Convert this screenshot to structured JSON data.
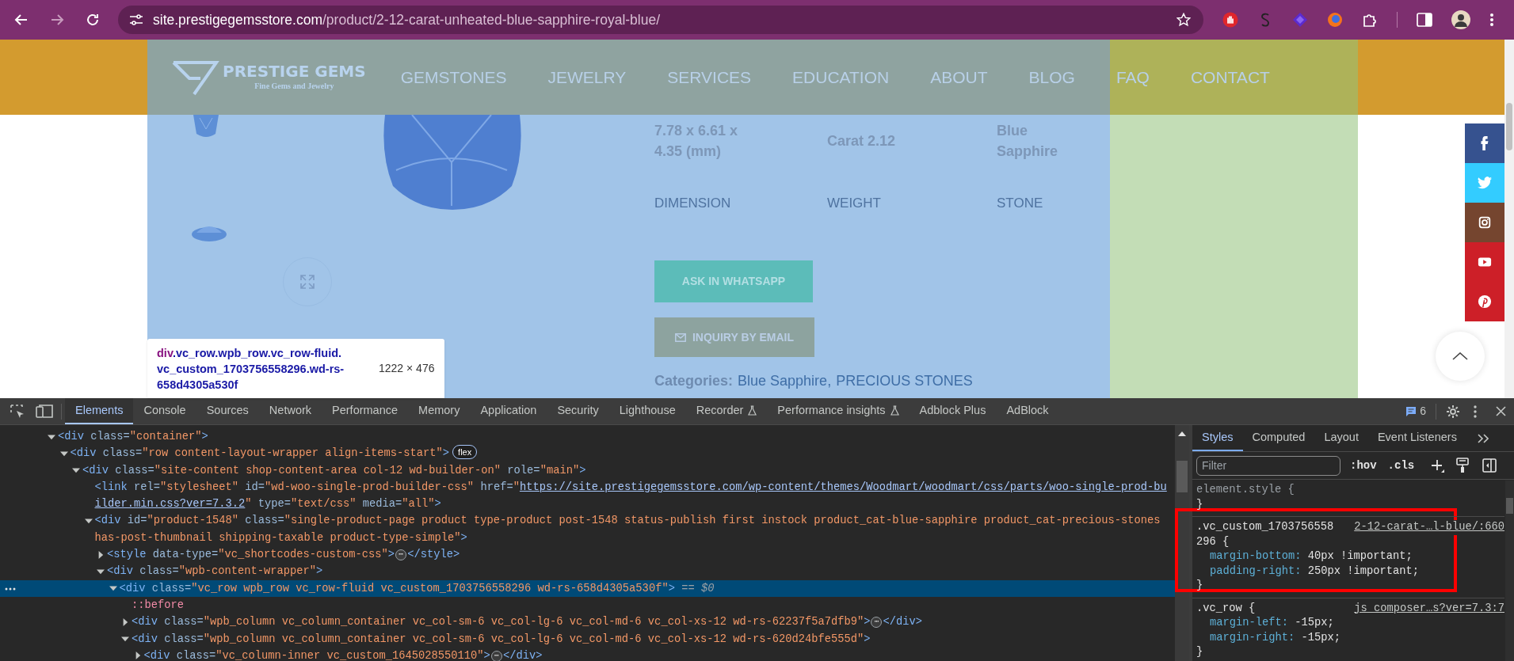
{
  "browser": {
    "url_host": "site.prestigegemsstore.com",
    "url_path": "/product/2-12-carat-unheated-blue-sapphire-royal-blue/"
  },
  "site": {
    "logo": {
      "name": "PRESTIGE GEMS",
      "tagline": "Fine Gems and Jewelry"
    },
    "nav": [
      "GEMSTONES",
      "JEWELRY",
      "SERVICES",
      "EDUCATION",
      "ABOUT",
      "BLOG",
      "FAQ",
      "CONTACT"
    ],
    "specs": [
      {
        "value": "7.78 x 6.61 x 4.35 (mm)",
        "label": "DIMENSION"
      },
      {
        "value": "Carat 2.12",
        "label": "WEIGHT"
      },
      {
        "value": "Blue Sapphire",
        "label": "STONE"
      }
    ],
    "buttons": [
      {
        "kind": "whatsapp",
        "label": "ASK IN WHATSAPP"
      },
      {
        "kind": "email",
        "label": "INQUIRY BY EMAIL"
      }
    ],
    "categories": {
      "label": "Categories:",
      "links": [
        "Blue Sapphire",
        "PRECIOUS STONES"
      ],
      "separator": ","
    },
    "social": [
      {
        "kind": "facebook",
        "color": "#36528f"
      },
      {
        "kind": "twitter",
        "color": "#33ccff"
      },
      {
        "kind": "instagram",
        "color": "#75452f"
      },
      {
        "kind": "youtube",
        "color": "#cd1f28"
      },
      {
        "kind": "pinterest",
        "color": "#cd1f28"
      }
    ]
  },
  "inspect_tooltip": {
    "tag": "div",
    "lines": [
      ".vc_row.wpb_row.vc_row-fluid.",
      "vc_custom_1703756558296.wd-rs-",
      "658d4305a530f"
    ],
    "size": "1222 × 476"
  },
  "devtools": {
    "tabs": [
      {
        "label": "Elements",
        "selected": true,
        "experimental": false
      },
      {
        "label": "Console",
        "selected": false,
        "experimental": false
      },
      {
        "label": "Sources",
        "selected": false,
        "experimental": false
      },
      {
        "label": "Network",
        "selected": false,
        "experimental": false
      },
      {
        "label": "Performance",
        "selected": false,
        "experimental": false
      },
      {
        "label": "Memory",
        "selected": false,
        "experimental": false
      },
      {
        "label": "Application",
        "selected": false,
        "experimental": false
      },
      {
        "label": "Security",
        "selected": false,
        "experimental": false
      },
      {
        "label": "Lighthouse",
        "selected": false,
        "experimental": false
      },
      {
        "label": "Recorder",
        "selected": false,
        "experimental": true
      },
      {
        "label": "Performance insights",
        "selected": false,
        "experimental": true
      },
      {
        "label": "Adblock Plus",
        "selected": false,
        "experimental": false
      },
      {
        "label": "AdBlock",
        "selected": false,
        "experimental": false
      }
    ],
    "issues_count": "6",
    "dom": [
      {
        "kind": "element",
        "expanded": true,
        "selected": false,
        "tokens": [
          {
            "kind": "tag",
            "text": "<div"
          },
          {
            "kind": "attr",
            "text": " class="
          },
          {
            "kind": "val",
            "text": "\"container\""
          },
          {
            "kind": "tag",
            "text": ">"
          }
        ],
        "children": [
          {
            "kind": "element",
            "expanded": true,
            "selected": false,
            "tokens": [
              {
                "kind": "tag",
                "text": "<div"
              },
              {
                "kind": "attr",
                "text": " class="
              },
              {
                "kind": "val",
                "text": "\"row content-layout-wrapper align-items-start\""
              },
              {
                "kind": "tag",
                "text": ">"
              },
              {
                "kind": "badge",
                "text": "flex"
              }
            ],
            "children": [
              {
                "kind": "element",
                "expanded": true,
                "selected": false,
                "tokens": [
                  {
                    "kind": "tag",
                    "text": "<div"
                  },
                  {
                    "kind": "attr",
                    "text": " class="
                  },
                  {
                    "kind": "val",
                    "text": "\"site-content shop-content-area col-12 wd-builder-on\""
                  },
                  {
                    "kind": "attr",
                    "text": " role="
                  },
                  {
                    "kind": "val",
                    "text": "\"main\""
                  },
                  {
                    "kind": "tag",
                    "text": ">"
                  }
                ],
                "children": [
                  {
                    "kind": "leaf",
                    "selected": false,
                    "tokens": [
                      {
                        "kind": "tag",
                        "text": "<link"
                      },
                      {
                        "kind": "attr",
                        "text": " rel="
                      },
                      {
                        "kind": "val",
                        "text": "\"stylesheet\""
                      },
                      {
                        "kind": "attr",
                        "text": " id="
                      },
                      {
                        "kind": "val",
                        "text": "\"wd-woo-single-prod-builder-css\""
                      },
                      {
                        "kind": "attr",
                        "text": " href="
                      },
                      {
                        "kind": "val",
                        "text": "\""
                      },
                      {
                        "kind": "link",
                        "text": "https://site.prestigegemsstore.com/wp-content/themes/Woodmart/woodmart/css/parts/woo-single-prod-builder.min.css?ver=7.3.2"
                      },
                      {
                        "kind": "val",
                        "text": "\""
                      },
                      {
                        "kind": "attr",
                        "text": " type="
                      },
                      {
                        "kind": "val",
                        "text": "\"text/css\""
                      },
                      {
                        "kind": "attr",
                        "text": " media="
                      },
                      {
                        "kind": "val",
                        "text": "\"all\""
                      },
                      {
                        "kind": "tag",
                        "text": ">"
                      }
                    ]
                  },
                  {
                    "kind": "element",
                    "expanded": true,
                    "selected": false,
                    "tokens": [
                      {
                        "kind": "tag",
                        "text": "<div"
                      },
                      {
                        "kind": "attr",
                        "text": " id="
                      },
                      {
                        "kind": "val",
                        "text": "\"product-1548\""
                      },
                      {
                        "kind": "attr",
                        "text": " class="
                      },
                      {
                        "kind": "val",
                        "text": "\"single-product-page product type-product post-1548 status-publish first instock product_cat-blue-sapphire product_cat-precious-stones has-post-thumbnail shipping-taxable product-type-simple\""
                      },
                      {
                        "kind": "tag",
                        "text": ">"
                      }
                    ],
                    "children": [
                      {
                        "kind": "element",
                        "expanded": false,
                        "selected": false,
                        "tokens": [
                          {
                            "kind": "tag",
                            "text": "<style"
                          },
                          {
                            "kind": "attr",
                            "text": " data-type="
                          },
                          {
                            "kind": "val",
                            "text": "\"vc_shortcodes-custom-css\""
                          },
                          {
                            "kind": "tag",
                            "text": ">"
                          },
                          {
                            "kind": "ellipsis",
                            "text": "⋯"
                          },
                          {
                            "kind": "tag",
                            "text": "</style>"
                          }
                        ]
                      },
                      {
                        "kind": "element",
                        "expanded": true,
                        "selected": false,
                        "tokens": [
                          {
                            "kind": "tag",
                            "text": "<div"
                          },
                          {
                            "kind": "attr",
                            "text": " class="
                          },
                          {
                            "kind": "val",
                            "text": "\"wpb-content-wrapper\""
                          },
                          {
                            "kind": "tag",
                            "text": ">"
                          }
                        ],
                        "children": [
                          {
                            "kind": "element",
                            "expanded": true,
                            "selected": true,
                            "tokens": [
                              {
                                "kind": "tag",
                                "text": "<div"
                              },
                              {
                                "kind": "attr",
                                "text": " class="
                              },
                              {
                                "kind": "val",
                                "text": "\"vc_row wpb_row vc_row-fluid vc_custom_1703756558296 wd-rs-658d4305a530f\""
                              },
                              {
                                "kind": "tag",
                                "text": ">"
                              },
                              {
                                "kind": "ref",
                                "text": " == $0"
                              }
                            ],
                            "children": [
                              {
                                "kind": "leaf",
                                "selected": false,
                                "tokens": [
                                  {
                                    "kind": "pseudo",
                                    "text": "::before"
                                  }
                                ]
                              },
                              {
                                "kind": "element",
                                "expanded": false,
                                "selected": false,
                                "tokens": [
                                  {
                                    "kind": "tag",
                                    "text": "<div"
                                  },
                                  {
                                    "kind": "attr",
                                    "text": " class="
                                  },
                                  {
                                    "kind": "val",
                                    "text": "\"wpb_column vc_column_container vc_col-sm-6 vc_col-lg-6 vc_col-md-6 vc_col-xs-12 wd-rs-62237f5a7dfb9\""
                                  },
                                  {
                                    "kind": "tag",
                                    "text": ">"
                                  },
                                  {
                                    "kind": "ellipsis",
                                    "text": "⋯"
                                  },
                                  {
                                    "kind": "tag",
                                    "text": "</div>"
                                  }
                                ]
                              },
                              {
                                "kind": "element",
                                "expanded": true,
                                "selected": false,
                                "tokens": [
                                  {
                                    "kind": "tag",
                                    "text": "<div"
                                  },
                                  {
                                    "kind": "attr",
                                    "text": " class="
                                  },
                                  {
                                    "kind": "val",
                                    "text": "\"wpb_column vc_column_container vc_col-sm-6 vc_col-lg-6 vc_col-md-6 vc_col-xs-12 wd-rs-620d24bfe555d\""
                                  },
                                  {
                                    "kind": "tag",
                                    "text": ">"
                                  }
                                ],
                                "children": [
                                  {
                                    "kind": "element",
                                    "expanded": false,
                                    "selected": false,
                                    "tokens": [
                                      {
                                        "kind": "tag",
                                        "text": "<div"
                                      },
                                      {
                                        "kind": "attr",
                                        "text": " class="
                                      },
                                      {
                                        "kind": "val",
                                        "text": "\"vc_column-inner vc_custom_1645028550110\""
                                      },
                                      {
                                        "kind": "tag",
                                        "text": ">"
                                      },
                                      {
                                        "kind": "ellipsis",
                                        "text": "⋯"
                                      },
                                      {
                                        "kind": "tag",
                                        "text": "</div>"
                                      }
                                    ]
                                  }
                                ]
                              }
                            ]
                          }
                        ]
                      }
                    ]
                  }
                ]
              }
            ]
          }
        ]
      }
    ],
    "styles": {
      "tabs": [
        {
          "label": "Styles",
          "selected": true
        },
        {
          "label": "Computed",
          "selected": false
        },
        {
          "label": "Layout",
          "selected": false
        },
        {
          "label": "Event Listeners",
          "selected": false
        }
      ],
      "filter_placeholder": "Filter",
      "toggles": [
        ":hov",
        ".cls"
      ],
      "rules": [
        {
          "kind": "inline",
          "selector": [
            "element.style {"
          ],
          "close": "}"
        },
        {
          "kind": "rule",
          "selector": [
            ".vc_custom_1703756558",
            "296 {"
          ],
          "source": "2-12-carat-…l-blue/:660",
          "declarations": [
            {
              "property": "margin-bottom:",
              "value": "40px !important;"
            },
            {
              "property": "padding-right:",
              "value": "250px !important;"
            }
          ],
          "close": "}"
        },
        {
          "kind": "rule",
          "selector": [
            ".vc_row {"
          ],
          "source": "js_composer…s?ver=7.3:7",
          "declarations": [
            {
              "property": "margin-left:",
              "value": "-15px;"
            },
            {
              "property": "margin-right:",
              "value": "-15px;"
            }
          ],
          "close": "}"
        }
      ]
    }
  }
}
